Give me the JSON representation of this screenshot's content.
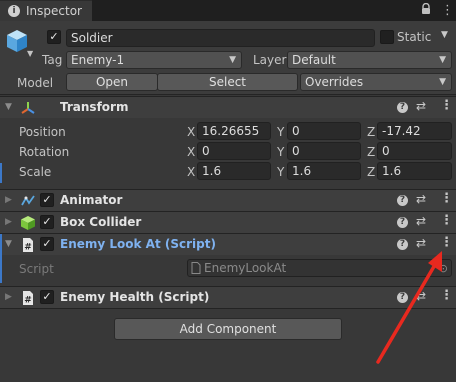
{
  "tab": {
    "title": "Inspector",
    "icon": "info-icon"
  },
  "toolbar": {
    "lock_icon": "lock-icon",
    "menu_icon": "kebab-icon"
  },
  "header": {
    "name": "Soldier",
    "static_label": "Static",
    "tag_label": "Tag",
    "tag_value": "Enemy-1",
    "layer_label": "Layer",
    "layer_value": "Default",
    "model_label": "Model",
    "open_label": "Open",
    "select_label": "Select",
    "overrides_label": "Overrides"
  },
  "transform": {
    "title": "Transform",
    "rows": [
      {
        "label": "Position",
        "x": "16.26655",
        "y": "0",
        "z": "-17.42"
      },
      {
        "label": "Rotation",
        "x": "0",
        "y": "0",
        "z": "0"
      },
      {
        "label": "Scale",
        "x": "1.6",
        "y": "1.6",
        "z": "1.6"
      }
    ],
    "axis_x": "X",
    "axis_y": "Y",
    "axis_z": "Z"
  },
  "components": {
    "animator": "Animator",
    "box_collider": "Box Collider",
    "enemy_look_at": "Enemy Look At (Script)",
    "script_label": "Script",
    "script_value": "EnemyLookAt",
    "enemy_health": "Enemy Health (Script)"
  },
  "add_component": "Add Component",
  "colors": {
    "accent_blue": "#7fb2f0",
    "annotation_red": "#e8291f",
    "background": "#383838"
  }
}
